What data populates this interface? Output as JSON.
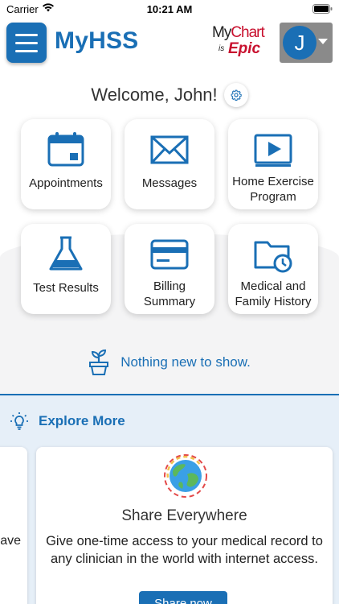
{
  "status_bar": {
    "carrier": "Carrier",
    "time": "10:21 AM"
  },
  "header": {
    "app_title": "MyHSS",
    "logo": {
      "my": "My",
      "chart": "Chart",
      "is": "is",
      "epic": "Epic"
    },
    "avatar_initial": "J"
  },
  "welcome": {
    "text": "Welcome, John!"
  },
  "tiles": [
    {
      "label": "Appointments",
      "icon": "calendar-icon"
    },
    {
      "label": "Messages",
      "icon": "envelope-icon"
    },
    {
      "label": "Home Exercise Program",
      "icon": "video-play-icon"
    },
    {
      "label": "Test Results",
      "icon": "flask-icon"
    },
    {
      "label": "Billing Summary",
      "icon": "credit-card-icon"
    },
    {
      "label": "Medical and Family History",
      "icon": "folder-clock-icon"
    }
  ],
  "empty_state": {
    "text": "Nothing new to show."
  },
  "explore": {
    "title": "Explore More",
    "prev_card_fragment": "ave",
    "card": {
      "title": "Share Everywhere",
      "description": "Give one-time access to your medical record to any clinician in the world with internet access.",
      "button_label": "Share now"
    }
  },
  "colors": {
    "brand_blue": "#1a6fb5",
    "epic_red": "#c8102e",
    "avatar_bg": "#8a8a8a",
    "section_bg": "#e6eff8"
  }
}
